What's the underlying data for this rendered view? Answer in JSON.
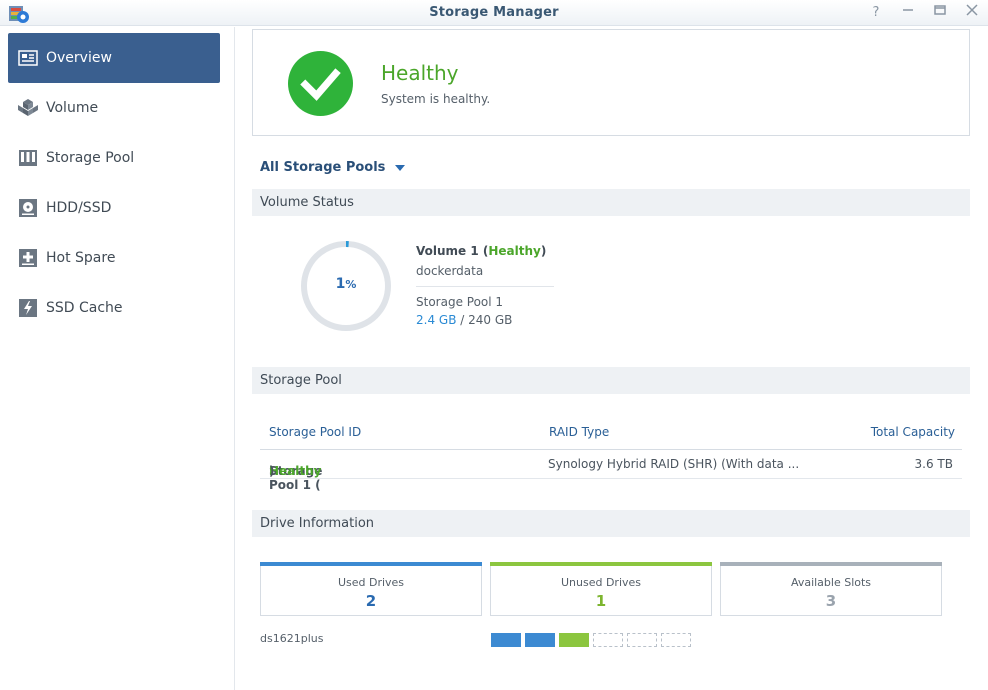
{
  "window": {
    "title": "Storage Manager"
  },
  "sidebar": {
    "items": [
      {
        "label": "Overview",
        "icon": "overview-icon",
        "active": true
      },
      {
        "label": "Volume",
        "icon": "volume-icon"
      },
      {
        "label": "Storage Pool",
        "icon": "storage-pool-icon"
      },
      {
        "label": "HDD/SSD",
        "icon": "hdd-icon"
      },
      {
        "label": "Hot Spare",
        "icon": "hot-spare-icon"
      },
      {
        "label": "SSD Cache",
        "icon": "ssd-cache-icon"
      }
    ]
  },
  "health": {
    "status": "Healthy",
    "message": "System is healthy."
  },
  "pool_selector": {
    "label": "All Storage Pools"
  },
  "volume_status": {
    "header": "Volume Status",
    "usage_percent": 1,
    "usage_number": "1",
    "usage_unit": "%",
    "name_prefix": "Volume 1 (",
    "state": "Healthy",
    "name_suffix": ")",
    "description": "dockerdata",
    "pool": "Storage Pool 1",
    "used": "2.4 GB",
    "separator": " / ",
    "total": "240 GB"
  },
  "storage_pool": {
    "header": "Storage Pool",
    "columns": {
      "id": "Storage Pool ID",
      "raid": "RAID Type",
      "capacity": "Total Capacity"
    },
    "row": {
      "id_prefix": "Storage Pool 1 (",
      "state": "Healthy",
      "id_suffix": ")",
      "raid": "Synology Hybrid RAID (SHR) (With data ...",
      "capacity": "3.6 TB"
    }
  },
  "drive_info": {
    "header": "Drive Information",
    "used_label": "Used Drives",
    "used_value": "2",
    "unused_label": "Unused Drives",
    "unused_value": "1",
    "slots_label": "Available Slots",
    "slots_value": "3",
    "model": "ds1621plus"
  },
  "colors": {
    "accent": "#3a5f8f",
    "healthy": "#4ba62a",
    "used": "#3c8ad2",
    "unused": "#8cc63f",
    "available": "#a8b1ba"
  }
}
